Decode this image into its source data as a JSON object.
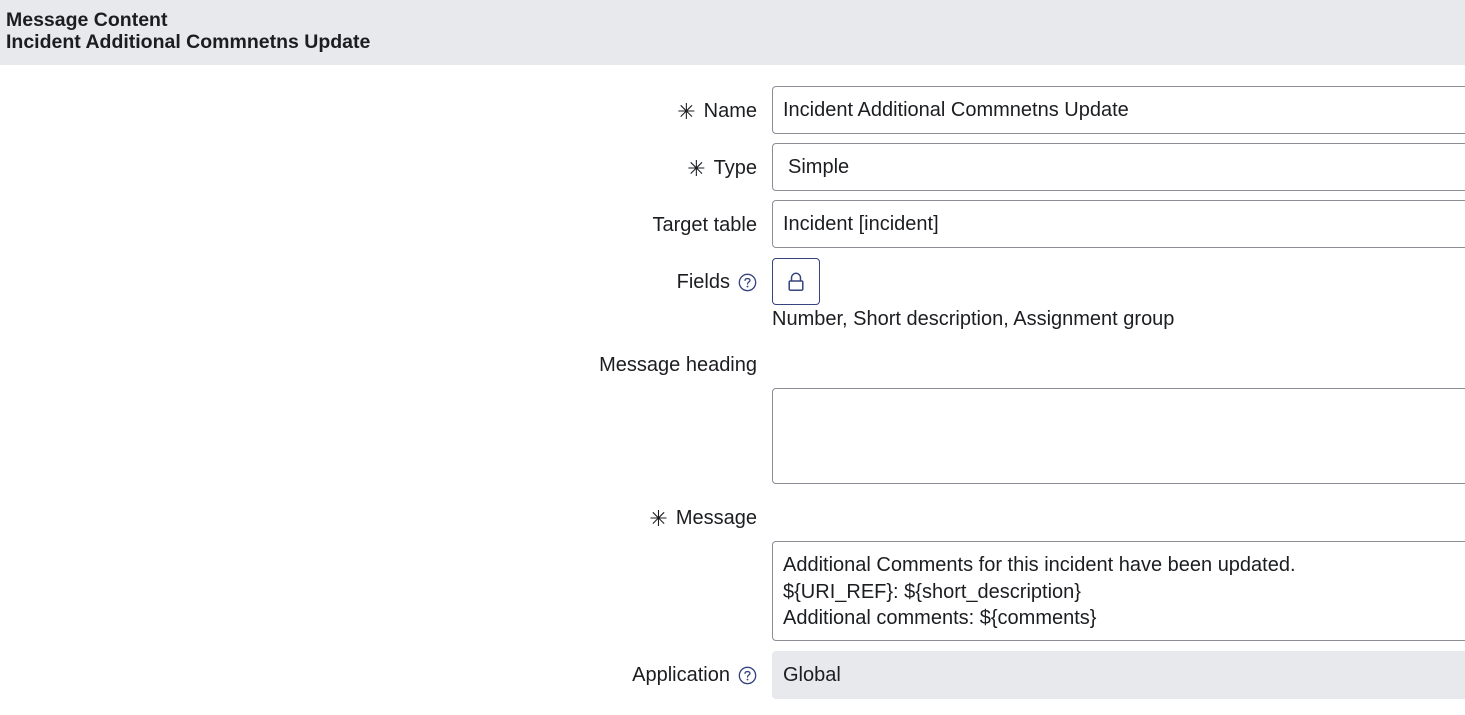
{
  "header": {
    "section_title": "Message Content",
    "record_title": "Incident Additional Commnetns Update"
  },
  "form": {
    "name": {
      "label": "Name",
      "required": true,
      "value": "Incident Additional Commnetns Update"
    },
    "type": {
      "label": "Type",
      "required": true,
      "value": "Simple"
    },
    "target_table": {
      "label": "Target table",
      "value": "Incident [incident]"
    },
    "fields": {
      "label": "Fields",
      "value": "Number, Short description, Assignment group"
    },
    "message_heading": {
      "label": "Message heading",
      "value": ""
    },
    "message": {
      "label": "Message",
      "required": true,
      "lines": [
        "Additional Comments for this incident have been updated.",
        "${URI_REF}: ${short_description}",
        "Additional comments: ${comments}"
      ]
    },
    "application": {
      "label": "Application",
      "value": "Global"
    }
  },
  "icons": {
    "required": "asterisk-icon",
    "help": "help-circle-icon",
    "fields_button": "lock-icon"
  },
  "colors": {
    "header_bg": "#e8e9ec",
    "border": "#8b8e95",
    "accent": "#37447e",
    "readonly_bg": "#e8e9ec"
  }
}
